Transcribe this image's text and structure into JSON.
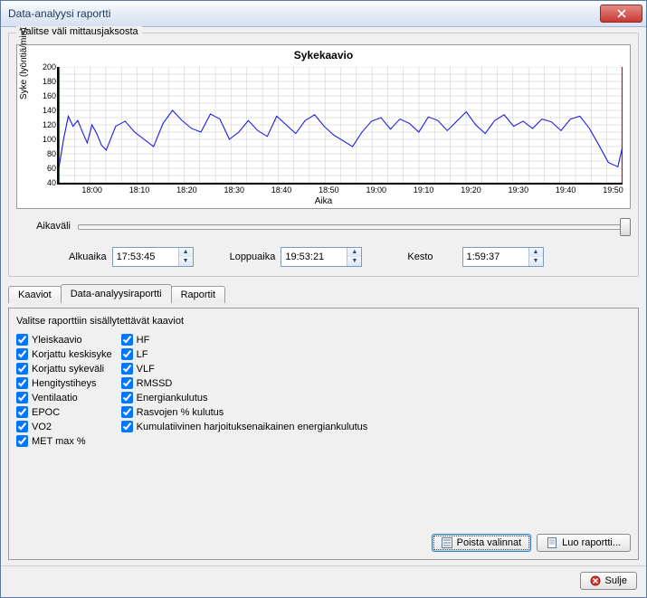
{
  "window": {
    "title": "Data-analyysi raportti"
  },
  "topGroup": {
    "label": "Valitse väli mittausjaksosta"
  },
  "chart": {
    "title": "Sykekaavio",
    "xlabel": "Aika",
    "ylabel": "Syke (lyöntiä/min)"
  },
  "sliderLabel": "Aikaväli",
  "timeFields": {
    "startLabel": "Alkuaika",
    "startValue": "17:53:45",
    "endLabel": "Loppuaika",
    "endValue": "19:53:21",
    "durationLabel": "Kesto",
    "durationValue": "1:59:37"
  },
  "tabs": {
    "items": [
      "Kaaviot",
      "Data-analyysiraportti",
      "Raportit"
    ],
    "activeIndex": 1
  },
  "reportGroup": {
    "label": "Valitse raporttiin sisällytettävät kaaviot"
  },
  "checkColumns": [
    [
      "Yleiskaavio",
      "Korjattu keskisyke",
      "Korjattu sykeväli",
      "Hengitystiheys",
      "Ventilaatio",
      "EPOC",
      "VO2",
      "MET max %"
    ],
    [
      "HF",
      "LF",
      "VLF",
      "RMSSD",
      "Energiankulutus",
      "Rasvojen % kulutus",
      "Kumulatiivinen harjoituksenaikainen energiankulutus"
    ]
  ],
  "buttons": {
    "clear": "Poista valinnat",
    "create": "Luo raportti...",
    "close": "Sulje"
  },
  "chart_data": {
    "type": "line",
    "title": "Sykekaavio",
    "xlabel": "Aika",
    "ylabel": "Syke (lyöntiä/min)",
    "ylim": [
      40,
      200
    ],
    "yticks": [
      40,
      60,
      80,
      100,
      120,
      140,
      160,
      180,
      200
    ],
    "xticks": [
      "18:00",
      "18:10",
      "18:20",
      "18:30",
      "18:40",
      "18:50",
      "19:00",
      "19:10",
      "19:20",
      "19:30",
      "19:40",
      "19:50"
    ],
    "x_minutes": [
      0,
      1,
      2,
      3,
      4,
      5,
      6,
      7,
      8,
      9,
      10,
      12,
      14,
      16,
      18,
      20,
      22,
      24,
      26,
      28,
      30,
      32,
      34,
      36,
      38,
      40,
      42,
      44,
      46,
      48,
      50,
      52,
      54,
      56,
      58,
      60,
      62,
      64,
      66,
      68,
      70,
      72,
      74,
      76,
      78,
      80,
      82,
      84,
      86,
      88,
      90,
      92,
      94,
      96,
      98,
      100,
      102,
      104,
      106,
      108,
      110,
      112,
      114,
      116,
      118,
      119
    ],
    "values": [
      60,
      100,
      132,
      118,
      126,
      110,
      95,
      120,
      108,
      92,
      85,
      118,
      125,
      110,
      100,
      90,
      122,
      140,
      126,
      115,
      110,
      135,
      128,
      100,
      110,
      126,
      112,
      104,
      132,
      120,
      108,
      126,
      134,
      118,
      106,
      98,
      90,
      110,
      125,
      130,
      114,
      128,
      122,
      110,
      131,
      126,
      112,
      125,
      138,
      120,
      108,
      126,
      134,
      118,
      125,
      115,
      128,
      124,
      112,
      128,
      132,
      115,
      92,
      68,
      62,
      90
    ],
    "markers": {
      "start_x_fraction": 0.0,
      "end_x_fraction": 1.0
    }
  }
}
